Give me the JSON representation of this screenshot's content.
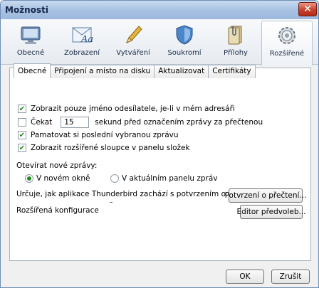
{
  "window": {
    "title": "Možnosti"
  },
  "toolbar": {
    "panes": [
      {
        "label": "Obecné",
        "icon": "general-icon"
      },
      {
        "label": "Zobrazení",
        "icon": "display-icon"
      },
      {
        "label": "Vytváření",
        "icon": "compose-icon"
      },
      {
        "label": "Soukromí",
        "icon": "privacy-icon"
      },
      {
        "label": "Přílohy",
        "icon": "attachments-icon"
      },
      {
        "label": "Rozšířené",
        "icon": "advanced-icon",
        "active": true
      }
    ]
  },
  "tabs": [
    "Obecné",
    "Připojení a místo na disku",
    "Aktualizovat",
    "Certifikáty"
  ],
  "options": {
    "show_name_only": {
      "label": "Zobrazit pouze jméno odesílatele, je-li v mém adresáři",
      "checked": true
    },
    "wait": {
      "label_before": "Čekat",
      "value": "15",
      "label_after": "sekund před označením zprávy za přečtenou",
      "checked": false
    },
    "remember_last": {
      "label": "Pamatovat si poslední vybranou zprávu",
      "checked": true
    },
    "show_extended_columns": {
      "label": "Zobrazit rozšířené sloupce v panelu složek",
      "checked": true
    },
    "open_messages_label": "Otevírat nové zprávy:",
    "open_new_window": {
      "label": "V novém okně",
      "selected": true
    },
    "open_message_pane": {
      "label": "V aktuálním panelu zpráv",
      "selected": false
    },
    "receipts_text": "Určuje, jak aplikace Thunderbird zachází s potvrzením o přečtení",
    "receipts_button": "Potvrzení o přečtení...",
    "config_text": "Rozšířená konfigurace",
    "config_button": "Editor předvoleb..."
  },
  "footer": {
    "ok": "OK",
    "cancel": "Zrušit"
  }
}
